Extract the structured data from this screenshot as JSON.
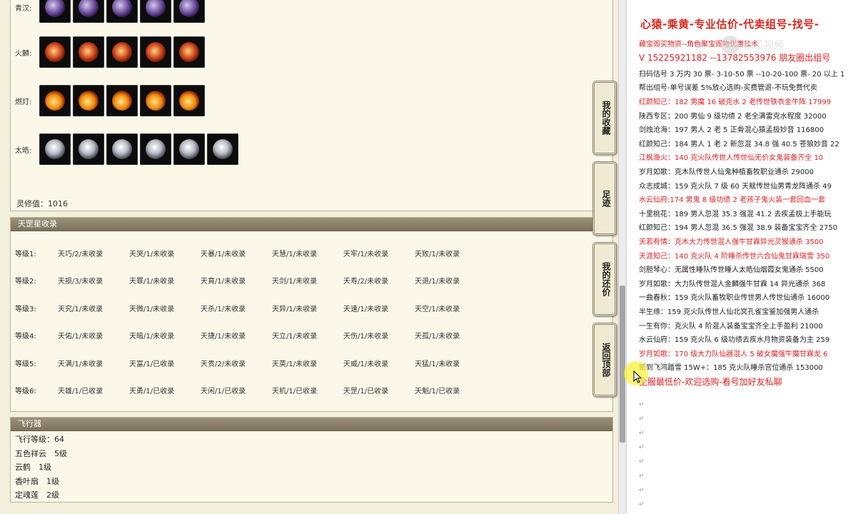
{
  "outfit": {
    "rows": [
      {
        "label": "青汉:",
        "count": 5,
        "tone": "purple"
      },
      {
        "label": "火麟:",
        "count": 5,
        "tone": "red"
      },
      {
        "label": "燃灯:",
        "count": 5,
        "tone": "fire"
      },
      {
        "label": "太皓:",
        "count": 6,
        "tone": "silver"
      }
    ],
    "lingxiu": "灵修值：1016"
  },
  "tiangang": {
    "title": "天罡星收录",
    "rows": [
      {
        "level": "等级1:",
        "cells": [
          "天巧/2/未收录",
          "天哭/1/未收录",
          "天暴/1/未收录",
          "天慧/1/未收录",
          "天牢/1/未收录",
          "天败/1/未收录"
        ]
      },
      {
        "level": "等级2:",
        "cells": [
          "天损/3/未收录",
          "天罪/1/未收录",
          "天賁/1/未收录",
          "天剑/1/未收录",
          "天寿/2/未收录",
          "天退/1/未收录"
        ]
      },
      {
        "level": "等级3:",
        "cells": [
          "天究/1/未收录",
          "天微/1/未收录",
          "天杀/1/未收录",
          "天异/1/未收录",
          "天速/1/未收录",
          "天空/1/未收录"
        ]
      },
      {
        "level": "等级4:",
        "cells": [
          "天佑/1/未收录",
          "天暗/1/未收录",
          "天捷/1/未收录",
          "天立/1/未收录",
          "天伤/1/未收录",
          "天孤/1/未收录"
        ]
      },
      {
        "level": "等级5:",
        "cells": [
          "天满/1/未收录",
          "天富/1/已收录",
          "天贵/2/未收录",
          "天英/1/未收录",
          "天威/1/未收录",
          "天猛/1/未收录"
        ]
      },
      {
        "level": "等级6:",
        "cells": [
          "天雄/1/已收录",
          "天勇/1/已收录",
          "天闲/1/已收录",
          "天机/1/已收录",
          "天罡/1/已收录",
          "天魁/1/已收录"
        ]
      }
    ]
  },
  "fly": {
    "title": "飞行器",
    "lines": [
      "飞行等级：64",
      "五色祥云　5级",
      "云鹤　1级",
      "香叶扇　1级",
      "定魂莲　2级"
    ]
  },
  "tabs": [
    {
      "label": "我的收藏"
    },
    {
      "label": "足迹"
    },
    {
      "label": "我的还价"
    },
    {
      "label": "返回顶部"
    }
  ],
  "right": {
    "title": "心猿-乘黄-专业估价-代卖组号-找号-",
    "lines": [
      {
        "text": "藏宝阁买物资--角色聚宝阁物优惠技术",
        "red": true
      },
      {
        "text": "V 15225921182 --13782553976 朋友圈出组号",
        "red": true,
        "big": true
      },
      {
        "text": "扫码估号 3 万内 30 票- 3-10-50 票 --10-20-100 票- 20 以上 1",
        "red": false
      },
      {
        "text": "帮出组号-单号误差 5%放心选购-买费管退-不玩免费代卖",
        "red": false
      },
      {
        "text": "红颜知己：182 男魔 16 破克水 2 老传世铁衣金牛阵 17999",
        "red": true
      },
      {
        "text": "陕西专区：200 男仙 9 级功绩 2 老全满雷克水程度 32000",
        "red": false
      },
      {
        "text": "剑烛沧海：197 男人 2 老 5 正骨混心猿孟极妙音 116800",
        "red": false
      },
      {
        "text": "红颜知己：184 男人 1 老 2 新忽混 34.8 强 40.5 苍狼妙音 22",
        "red": false
      },
      {
        "text": "江枫渔火：140 克火队传世人传世仙无价女鬼装备齐全 10",
        "red": true
      },
      {
        "text": "岁月如歌：克木队传世人仙鬼种植畜牧职业通杀 29000",
        "red": false
      },
      {
        "text": "众志成城：159 克火队 7 级 60 天赋传世仙男青龙阵通杀 49",
        "red": false
      },
      {
        "text": "水云仙府:174 男鬼 8 级功绩 2 老孩子鬼火装一套回血一套",
        "red": true
      },
      {
        "text": "十里桃花：189 男人忽混 35.3 强混 41.2 去疾孟极上手能玩",
        "red": false
      },
      {
        "text": "红颜知己：194 男人忽混 36.5 强混 38.9 装备宝宝齐全 2750",
        "red": false
      },
      {
        "text": "天若有情：克木大力传世混人强牛甘霖异光灵猴通杀 3500",
        "red": true
      },
      {
        "text": "天涯知己：140 克火队 4 阶睡杀传世六合仙鬼甘霖瑞雪 350",
        "red": true
      },
      {
        "text": "剑胆琴心：无属性睡队传世睡人太皓仙烟霞女鬼通杀 5500",
        "red": false
      },
      {
        "text": "岁月如歌：大力队传世混人金麟强牛甘霖 14 异光通杀 368",
        "red": false
      },
      {
        "text": "一曲春秋：159 克火队畜牧职业传世男人传世仙通杀 16000",
        "red": false
      },
      {
        "text": "半生缘：159 克火队传世人仙北冥孔雀宝鉴加强男人通杀",
        "red": false
      },
      {
        "text": "一生有你：克火队 4 阶混人装备宝宝齐全上手盈利 21000",
        "red": false
      },
      {
        "text": "水云仙府：159 克火队 6 级功绩去疾水月物资装备为主 259",
        "red": false
      },
      {
        "text": "岁月如歌：170 级大力队仙器混人 5 破女魔强牛魔甘霖龙 6",
        "red": true
      },
      {
        "text": "新到飞鸿踏雪 15W+：185 克火队睡杀宫位通杀 153000",
        "red": false
      },
      {
        "text": "全服最低价-欢迎选购-看号加好友私聊",
        "red": true,
        "big": true
      }
    ],
    "para_mark": "↵"
  },
  "watermark": "西瓜视频"
}
